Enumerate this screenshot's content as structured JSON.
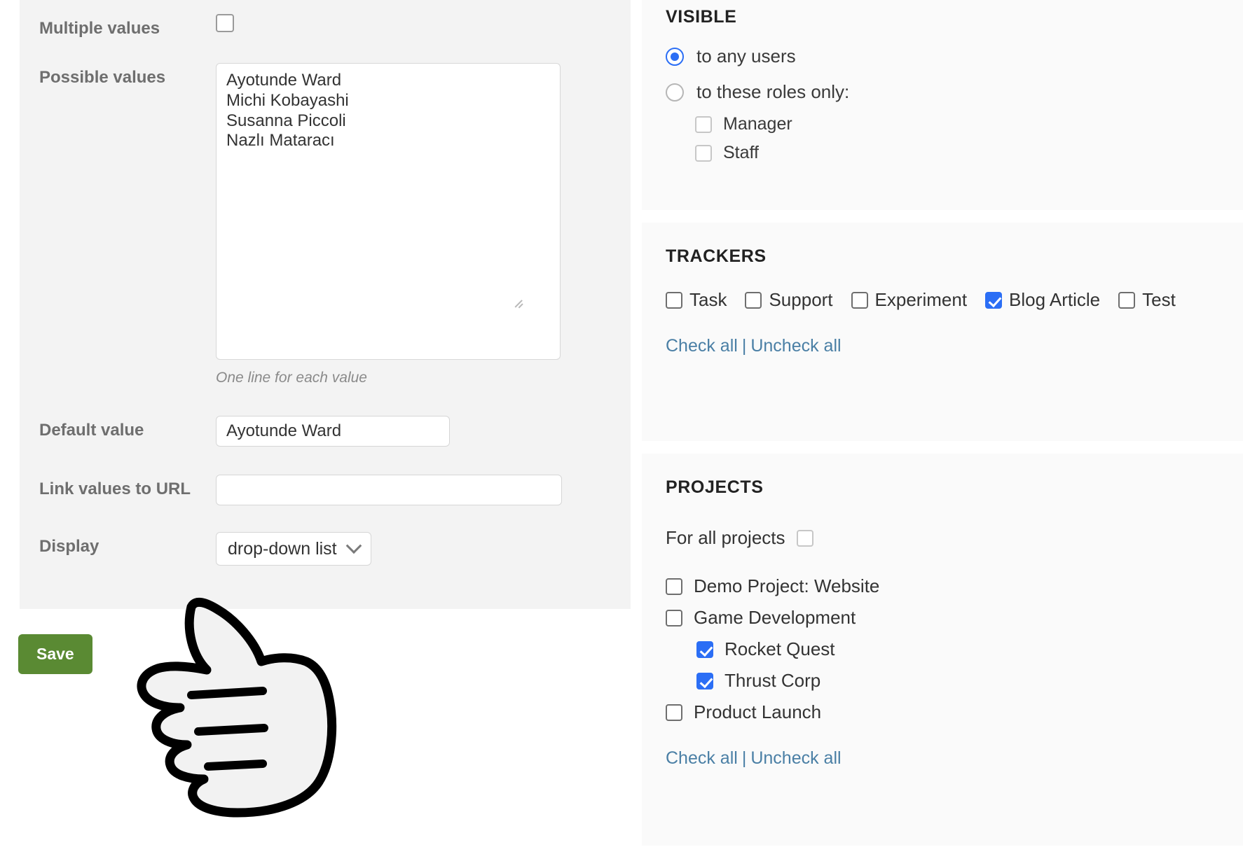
{
  "form": {
    "multiple_values_label": "Multiple values",
    "multiple_values_checked": false,
    "possible_values_label": "Possible values",
    "possible_values_text": "Ayotunde Ward\nMichi Kobayashi\nSusanna Piccoli\nNazlı Mataracı",
    "possible_values_hint": "One line for each value",
    "default_value_label": "Default value",
    "default_value": "Ayotunde Ward",
    "link_values_label": "Link values to URL",
    "link_values_value": "",
    "display_label": "Display",
    "display_value": "drop-down list",
    "save_label": "Save"
  },
  "visible": {
    "title": "VISIBLE",
    "options": [
      {
        "label": "to any users",
        "selected": true
      },
      {
        "label": "to these roles only:",
        "selected": false
      }
    ],
    "roles": [
      {
        "label": "Manager",
        "checked": false
      },
      {
        "label": "Staff",
        "checked": false
      }
    ]
  },
  "trackers": {
    "title": "TRACKERS",
    "items": [
      {
        "label": "Task",
        "checked": false
      },
      {
        "label": "Support",
        "checked": false
      },
      {
        "label": "Experiment",
        "checked": false
      },
      {
        "label": "Blog Article",
        "checked": true
      },
      {
        "label": "Test",
        "checked": false
      }
    ],
    "check_all": "Check all",
    "separator": "|",
    "uncheck_all": "Uncheck all"
  },
  "projects": {
    "title": "PROJECTS",
    "for_all_label": "For all projects",
    "for_all_checked": false,
    "items": [
      {
        "label": "Demo Project: Website",
        "checked": false,
        "indent": false
      },
      {
        "label": "Game Development",
        "checked": false,
        "indent": false
      },
      {
        "label": "Rocket Quest",
        "checked": true,
        "indent": true
      },
      {
        "label": "Thrust Corp",
        "checked": true,
        "indent": true
      },
      {
        "label": "Product Launch",
        "checked": false,
        "indent": false
      }
    ],
    "check_all": "Check all",
    "separator": "|",
    "uncheck_all": "Uncheck all"
  },
  "colors": {
    "accent_blue": "#2b6ef5",
    "link_blue": "#4a7fa5",
    "save_green": "#5a8a33",
    "panel_grey": "#f3f3f3",
    "card_grey": "#fafafa"
  }
}
